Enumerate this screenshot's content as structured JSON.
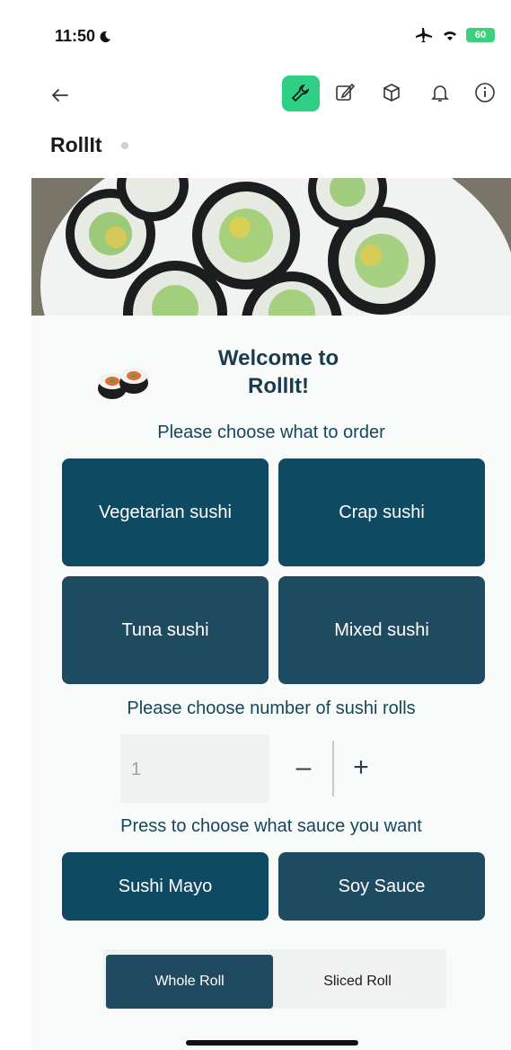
{
  "status": {
    "time": "11:50",
    "battery": "60"
  },
  "app": {
    "title": "RollIt"
  },
  "welcome": {
    "title": "Welcome to\nRollIt!"
  },
  "order": {
    "prompt": "Please choose what to order",
    "options": [
      "Vegetarian sushi",
      "Crap sushi",
      "Tuna sushi",
      "Mixed sushi"
    ]
  },
  "quantity": {
    "prompt": "Please choose number of sushi rolls",
    "value": "1",
    "minus": "–",
    "plus": "+"
  },
  "sauce": {
    "prompt": "Press to choose what sauce you want",
    "options": [
      "Sushi Mayo",
      "Soy Sauce"
    ]
  },
  "roll_type": {
    "options": [
      "Whole Roll",
      "Sliced Roll"
    ],
    "selected": "Whole Roll"
  },
  "colors": {
    "accent": "#2ed085",
    "button": "#104a62",
    "button_dark": "#1f4b61",
    "text_heading": "#193c4c"
  }
}
